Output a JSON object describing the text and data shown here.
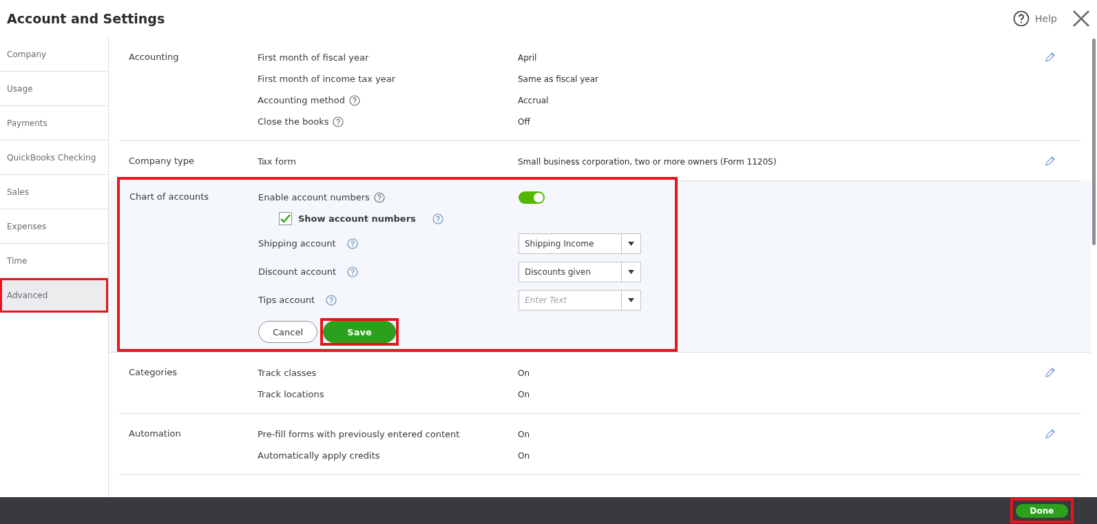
{
  "window": {
    "title": "Account and Settings",
    "help": "Help"
  },
  "nav": [
    {
      "label": "Company",
      "selected": false,
      "highlighted": false
    },
    {
      "label": "Usage",
      "selected": false,
      "highlighted": false
    },
    {
      "label": "Payments",
      "selected": false,
      "highlighted": false
    },
    {
      "label": "QuickBooks Checking",
      "selected": false,
      "highlighted": false
    },
    {
      "label": "Sales",
      "selected": false,
      "highlighted": false
    },
    {
      "label": "Expenses",
      "selected": false,
      "highlighted": false
    },
    {
      "label": "Time",
      "selected": false,
      "highlighted": false
    },
    {
      "label": "Advanced",
      "selected": true,
      "highlighted": true
    }
  ],
  "sections": [
    {
      "kind": "rows",
      "title": "Accounting",
      "rows": [
        {
          "label": "First month of fiscal year",
          "help": false,
          "value": "April"
        },
        {
          "label": "First month of income tax year",
          "help": false,
          "value": "Same as fiscal year"
        },
        {
          "label": "Accounting method",
          "help": true,
          "value": "Accrual"
        },
        {
          "label": "Close the books",
          "help": true,
          "value": "Off"
        }
      ]
    },
    {
      "kind": "rows",
      "title": "Company type",
      "rows": [
        {
          "label": "Tax form",
          "help": false,
          "value": "Small business corporation, two or more owners (Form 1120S)"
        }
      ]
    },
    {
      "kind": "form",
      "title": "Chart of accounts",
      "highlighted": true,
      "toggle": {
        "label": "Enable account numbers",
        "on": true
      },
      "checkbox": {
        "label": "Show account numbers",
        "checked": true
      },
      "selects": [
        {
          "label": "Shipping account",
          "value": "Shipping Income"
        },
        {
          "label": "Discount account",
          "value": "Discounts given"
        },
        {
          "label": "Tips account",
          "placeholder": "Enter Text"
        }
      ],
      "cancel": "Cancel",
      "save": {
        "label": "Save",
        "highlighted": true
      }
    },
    {
      "kind": "rows",
      "title": "Categories",
      "rows": [
        {
          "label": "Track classes",
          "help": false,
          "value": "On"
        },
        {
          "label": "Track locations",
          "help": false,
          "value": "On"
        }
      ]
    },
    {
      "kind": "rows",
      "title": "Automation",
      "rows": [
        {
          "label": "Pre-fill forms with previously entered content",
          "help": false,
          "value": "On"
        },
        {
          "label": "Automatically apply credits",
          "help": false,
          "value": "On"
        }
      ]
    }
  ],
  "footer": {
    "done": {
      "label": "Done",
      "highlighted": true
    }
  }
}
